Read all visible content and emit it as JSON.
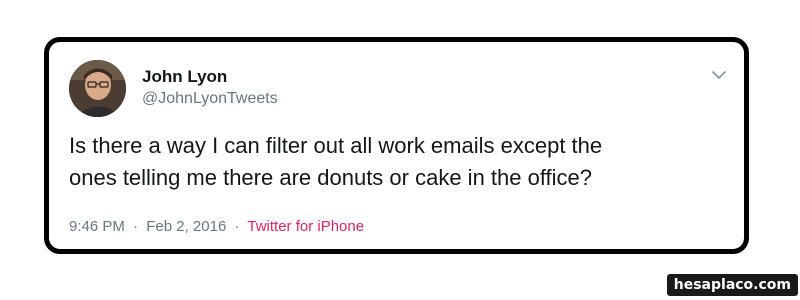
{
  "tweet": {
    "author_name": "John Lyon",
    "author_handle": "@JohnLyonTweets",
    "text_lines": [
      "Is there a way I can filter out all work emails except the",
      "ones telling me there are donuts or cake in the office?"
    ],
    "time": "9:46 PM",
    "separator": "·",
    "date": "Feb 2, 2016",
    "source": "Twitter for iPhone",
    "menu_icon": "chevron-down-icon"
  },
  "watermark": {
    "text": "hesaplaco.com"
  },
  "colors": {
    "name": "#14171a",
    "secondary": "#657786",
    "source_link": "#e0245e",
    "card_border": "#000000"
  }
}
